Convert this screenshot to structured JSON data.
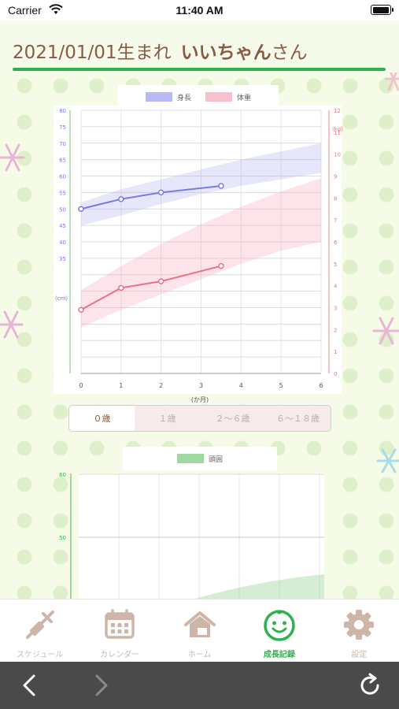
{
  "status_bar": {
    "carrier": "Carrier",
    "time": "11:40 AM"
  },
  "header": {
    "birth": "2021/01/01生まれ",
    "name": "いいちゃん",
    "suffix": "さん"
  },
  "growth_chart": {
    "legend": [
      {
        "label": "身長",
        "color": "#b8b8f5"
      },
      {
        "label": "体重",
        "color": "#f8c0cc"
      }
    ],
    "left_axis_unit": "(cm)",
    "right_axis_unit": "(kg)",
    "x_axis_unit": "(か月)"
  },
  "age_tabs": [
    {
      "label": "０歳",
      "active": true
    },
    {
      "label": "１歳",
      "active": false
    },
    {
      "label": "２〜６歳",
      "active": false
    },
    {
      "label": "６〜１８歳",
      "active": false
    }
  ],
  "head_chart": {
    "legend": [
      {
        "label": "頭囲",
        "color": "#9fd8a0"
      }
    ]
  },
  "tab_bar": [
    {
      "label": "スケジュール",
      "icon": "syringe-icon",
      "active": false
    },
    {
      "label": "カレンダー",
      "icon": "calendar-icon",
      "active": false
    },
    {
      "label": "ホーム",
      "icon": "home-icon",
      "active": false
    },
    {
      "label": "成長記録",
      "icon": "baby-face-icon",
      "active": true
    },
    {
      "label": "設定",
      "icon": "gear-icon",
      "active": false
    }
  ],
  "chart_data": [
    {
      "type": "line",
      "title": "",
      "xlabel": "(か月)",
      "ylabel": "(cm)",
      "y2label": "(kg)",
      "xlim": [
        0,
        6
      ],
      "ylim": [
        0,
        80
      ],
      "y2lim": [
        0,
        12
      ],
      "x_ticks": [
        0,
        1,
        2,
        3,
        4,
        5,
        6
      ],
      "y_ticks": [
        35,
        40,
        45,
        50,
        55,
        60,
        65,
        70,
        75,
        80
      ],
      "y2_ticks": [
        0,
        1,
        2,
        3,
        4,
        5,
        6,
        7,
        8,
        9,
        10,
        11,
        12
      ],
      "grid": true,
      "legend_position": "top",
      "series": [
        {
          "name": "身長",
          "axis": "left",
          "color": "#7b7be8",
          "x": [
            0,
            1,
            2,
            3.5
          ],
          "values": [
            50,
            53,
            55,
            57
          ]
        },
        {
          "name": "体重",
          "axis": "right",
          "color": "#ee7088",
          "x": [
            0,
            1,
            2,
            3.5
          ],
          "values": [
            2.9,
            3.9,
            4.2,
            4.9
          ]
        }
      ],
      "bands": [
        {
          "series": "身長",
          "x": [
            0,
            1,
            2,
            3,
            4,
            5,
            6
          ],
          "low": [
            45,
            48,
            51.5,
            54.5,
            57,
            59,
            61
          ],
          "high": [
            52,
            56,
            59,
            62,
            65,
            67.5,
            70
          ]
        },
        {
          "series": "体重",
          "x": [
            0,
            1,
            2,
            3,
            4,
            5,
            6
          ],
          "low": [
            2.1,
            2.9,
            3.6,
            4.3,
            5.0,
            5.6,
            6.0
          ],
          "high": [
            3.8,
            4.9,
            5.9,
            6.8,
            7.6,
            8.3,
            8.9
          ]
        }
      ]
    },
    {
      "type": "area",
      "xlabel": "",
      "ylabel": "",
      "y_ticks_visible": [
        50,
        60
      ],
      "grid": true,
      "legend_position": "top",
      "series": [
        {
          "name": "頭囲",
          "color": "#9fd8a0"
        }
      ]
    }
  ]
}
